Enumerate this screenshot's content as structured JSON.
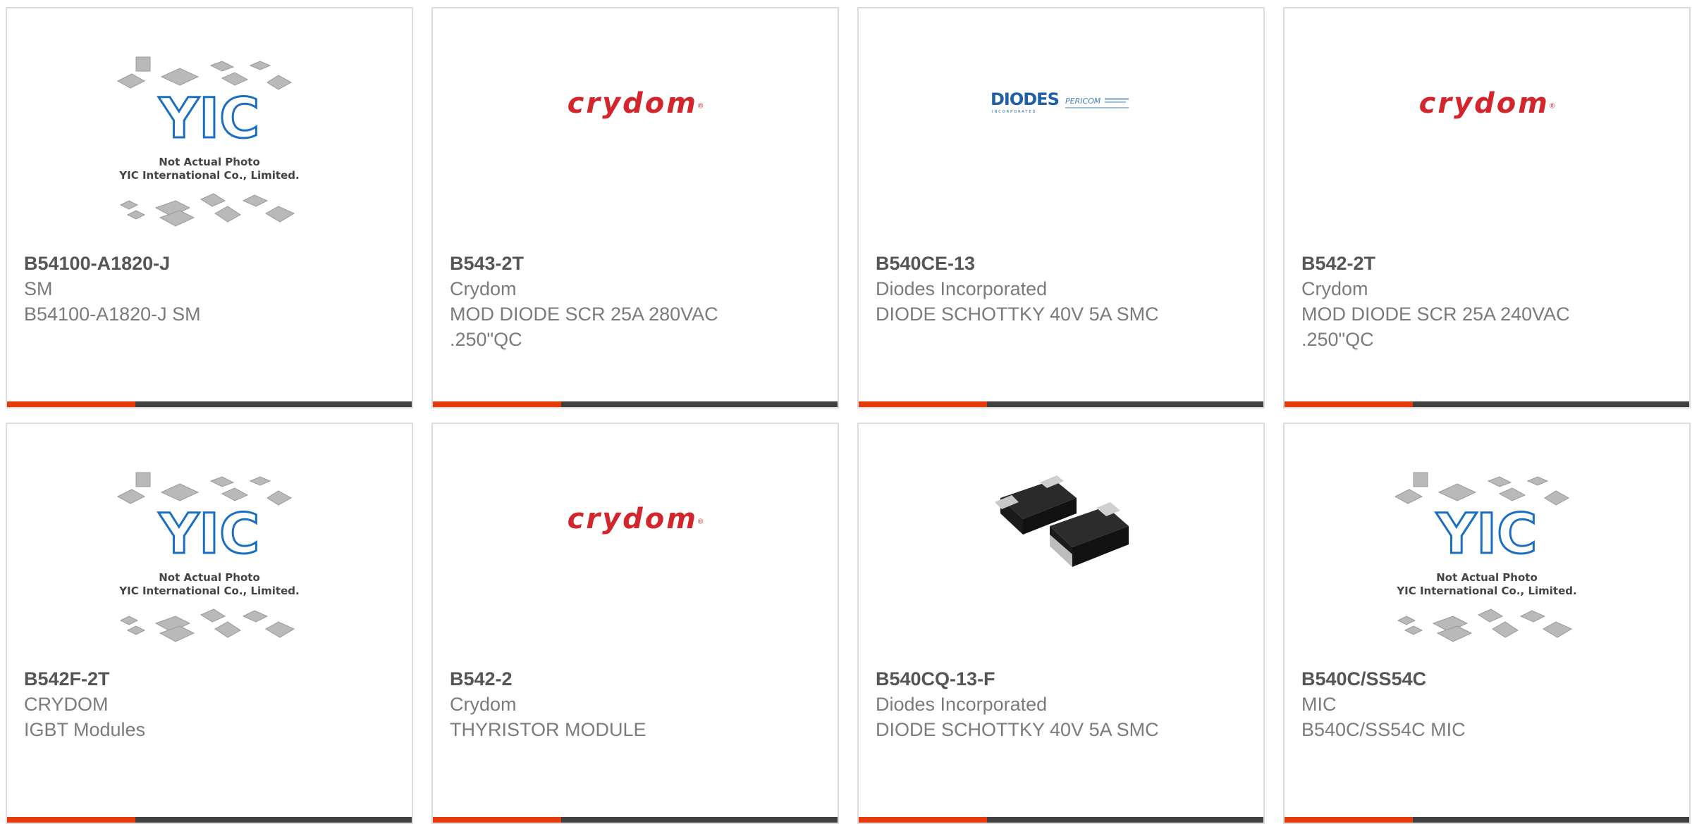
{
  "products": [
    {
      "part_number": "B54100-A1820-J",
      "manufacturer": "SM",
      "description": "B54100-A1820-J SM",
      "image": "yic-placeholder"
    },
    {
      "part_number": "B543-2T",
      "manufacturer": "Crydom",
      "description": "MOD DIODE SCR 25A 280VAC .250\"QC",
      "image": "crydom-logo"
    },
    {
      "part_number": "B540CE-13",
      "manufacturer": "Diodes Incorporated",
      "description": "DIODE SCHOTTKY 40V 5A SMC",
      "image": "diodes-logo"
    },
    {
      "part_number": "B542-2T",
      "manufacturer": "Crydom",
      "description": "MOD DIODE SCR 25A 240VAC .250\"QC",
      "image": "crydom-logo"
    },
    {
      "part_number": "B542F-2T",
      "manufacturer": "CRYDOM",
      "description": "IGBT Modules",
      "image": "yic-placeholder"
    },
    {
      "part_number": "B542-2",
      "manufacturer": "Crydom",
      "description": "THYRISTOR MODULE",
      "image": "crydom-logo"
    },
    {
      "part_number": "B540CQ-13-F",
      "manufacturer": "Diodes Incorporated",
      "description": "DIODE SCHOTTKY 40V 5A SMC",
      "image": "smc-diode-photo"
    },
    {
      "part_number": "B540C/SS54C",
      "manufacturer": "MIC",
      "description": "B540C/SS54C MIC",
      "image": "yic-placeholder"
    }
  ],
  "logos": {
    "crydom": "crydom",
    "diodes": "DIODES",
    "diodes_sub": "INCORPORATED",
    "pericom": "PERICOM",
    "yic_mark": "YIC",
    "yic_caption_1": "Not Actual Photo",
    "yic_caption_2": "YIC International Co., Limited."
  },
  "colors": {
    "accent_bar": "#e63a0a",
    "dark_bar": "#404040",
    "crydom_red": "#d3262c",
    "diodes_blue": "#1f5fa8",
    "yic_blue": "#1b6fc0",
    "card_border": "#dcdcdc"
  }
}
